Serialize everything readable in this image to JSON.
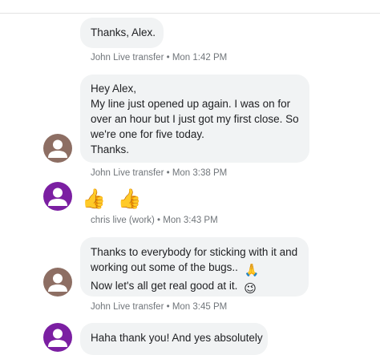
{
  "colors": {
    "bubble_bg": "#f1f3f4",
    "avatar_brown": "#8d6e63",
    "avatar_purple": "#7b1fa2",
    "meta_text": "#70757a"
  },
  "messages": [
    {
      "lines": [
        "Thanks, Alex."
      ],
      "meta": "John Live transfer • Mon 1:42 PM"
    },
    {
      "lines": [
        "Hey Alex,",
        "My line just opened up again. I was on for",
        "over an hour but I just got my first close. So",
        "we're one for five today.",
        "Thanks."
      ],
      "meta": "John Live transfer • Mon 3:38 PM"
    },
    {
      "emoji": [
        "👍",
        "👍"
      ],
      "meta": "chris live (work) • Mon 3:43 PM"
    },
    {
      "lines": [
        "Thanks to everybody for sticking with it and",
        "working out some of the bugs..",
        "Now let's all get real good at it."
      ],
      "emoji_inline": [
        "🙏",
        "😉"
      ],
      "meta": "John Live transfer • Mon 3:45 PM"
    },
    {
      "lines": [
        "Haha thank you! And yes absolutely"
      ]
    }
  ]
}
